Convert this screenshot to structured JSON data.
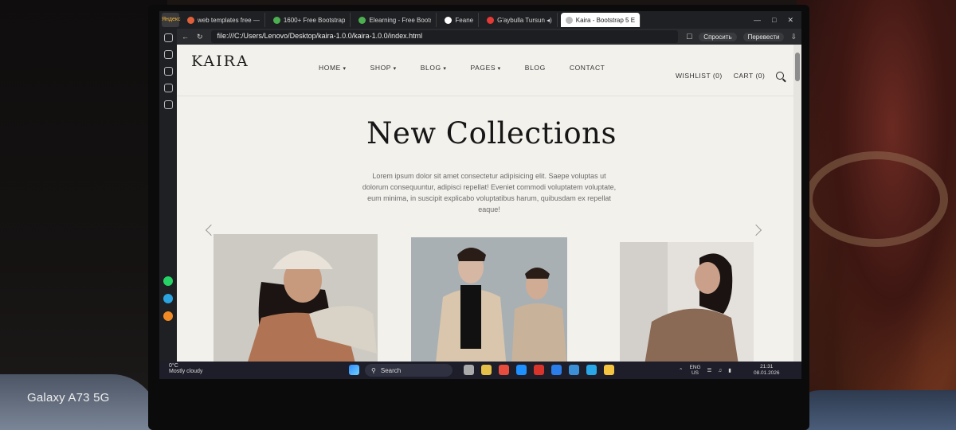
{
  "photo": {
    "watermark": "Galaxy A73 5G"
  },
  "browser": {
    "ya_badge": "Яндекс",
    "tabs": [
      {
        "label": "web templates free —",
        "color": "#e0603a",
        "active": false
      },
      {
        "label": "1600+ Free Bootstrap",
        "color": "#4caf50",
        "active": false
      },
      {
        "label": "Elearning - Free Bootstr",
        "color": "#4caf50",
        "active": false
      },
      {
        "label": "Feane",
        "color": "#ffffff",
        "active": false
      },
      {
        "label": "G'aybulla Tursun ◂)",
        "color": "#e53935",
        "active": false
      },
      {
        "label": "Kaira - Bootstrap 5 E",
        "color": "#bbbbbb",
        "active": true
      }
    ],
    "url": "file:///C:/Users/Lenovo/Desktop/kaira-1.0.0/kaira-1.0.0/index.html",
    "ask_label": "Спросить",
    "translate_label": "Перевести"
  },
  "site": {
    "logo": "KAIRA",
    "nav": [
      {
        "label": "HOME",
        "dropdown": true
      },
      {
        "label": "SHOP",
        "dropdown": true
      },
      {
        "label": "BLOG",
        "dropdown": true
      },
      {
        "label": "PAGES",
        "dropdown": true
      },
      {
        "label": "BLOG",
        "dropdown": false
      },
      {
        "label": "CONTACT",
        "dropdown": false
      }
    ],
    "wishlist": "WISHLIST (0)",
    "cart": "CART (0)",
    "hero_title": "New Collections",
    "hero_text": "Lorem ipsum dolor sit amet consectetur adipisicing elit. Saepe voluptas ut dolorum consequuntur, adipisci repellat! Eveniet commodi voluptatem voluptate, eum minima, in suscipit explicabo voluptatibus harum, quibusdam ex repellat eaque!"
  },
  "taskbar": {
    "temperature": "0°C",
    "weather": "Mostly cloudy",
    "search_placeholder": "Search",
    "lang_top": "ENG",
    "lang_bottom": "US",
    "time": "21:31",
    "date": "08.01.2026"
  }
}
